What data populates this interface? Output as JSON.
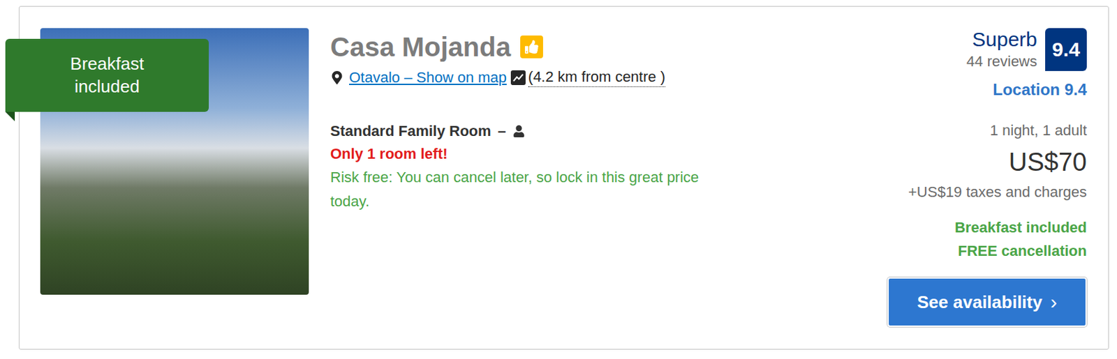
{
  "ribbon": "Breakfast included",
  "hotel": {
    "name": "Casa Mojanda"
  },
  "location": {
    "link": "Otavalo – Show on map",
    "distance": "(4.2 km from centre )"
  },
  "room": {
    "name": "Standard Family Room",
    "separator": "–",
    "scarcity": "Only 1 room left!",
    "note": "Risk free: You can cancel later, so lock in this great price today."
  },
  "rating": {
    "label": "Superb",
    "reviews": "44 reviews",
    "score": "9.4",
    "location": "Location 9.4"
  },
  "price": {
    "stay": "1 night, 1 adult",
    "amount": "US$70",
    "taxes": "+US$19 taxes and charges"
  },
  "perks": [
    "Breakfast included",
    "FREE cancellation"
  ],
  "button": {
    "label": "See availability",
    "chevron": "›"
  }
}
